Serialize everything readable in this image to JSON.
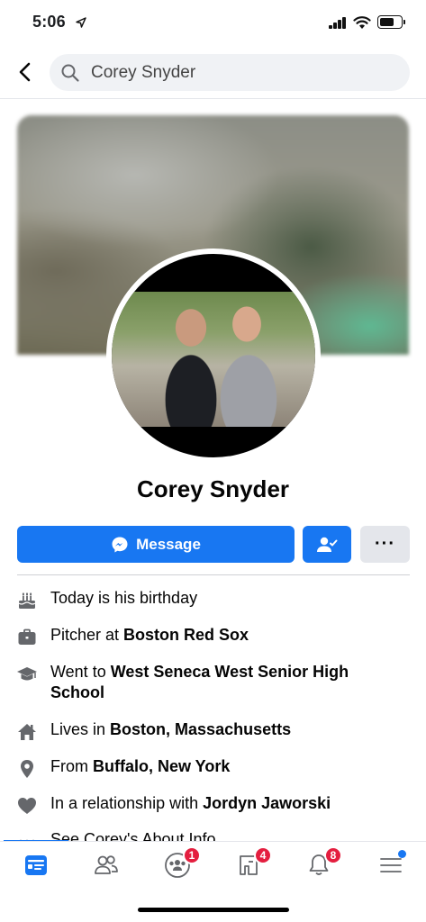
{
  "status_bar": {
    "time": "5:06",
    "location_arrow": "location-arrow-icon"
  },
  "search": {
    "value": "Corey Snyder",
    "icon": "search-icon"
  },
  "profile": {
    "name": "Corey Snyder"
  },
  "actions": {
    "message_label": "Message",
    "more_label": "···"
  },
  "info": {
    "birthday": {
      "text": "Today is his birthday"
    },
    "work": {
      "prefix": "Pitcher at ",
      "bold": "Boston Red Sox"
    },
    "education": {
      "prefix": "Went to ",
      "bold": "West Seneca West Senior High School"
    },
    "lives": {
      "prefix": "Lives in ",
      "bold": "Boston, Massachusetts"
    },
    "from": {
      "prefix": "From ",
      "bold": "Buffalo, New York"
    },
    "relationship": {
      "prefix": "In a relationship with ",
      "bold": "Jordyn Jaworski"
    },
    "about": {
      "text": "See Corey's About Info"
    }
  },
  "tabbar": {
    "groups_badge": "1",
    "marketplace_badge": "4",
    "notifications_badge": "8"
  },
  "colors": {
    "accent": "#1877f2",
    "badge": "#e41e3f",
    "secondary_button": "#e4e6eb"
  }
}
